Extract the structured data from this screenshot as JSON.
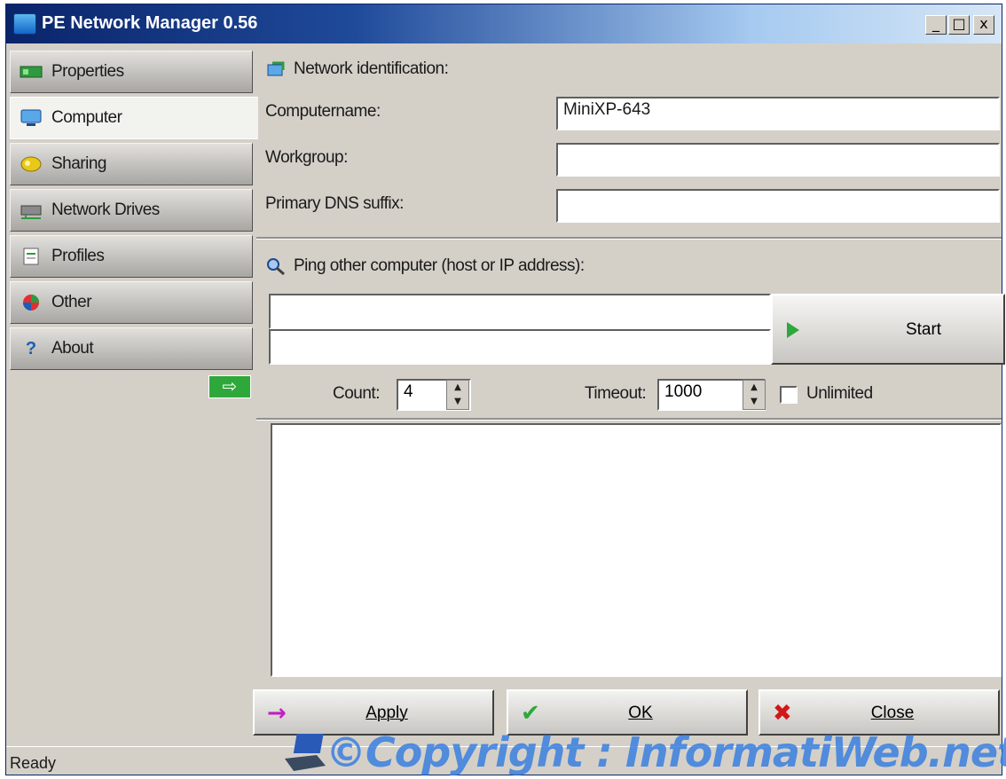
{
  "window": {
    "title": "PE Network Manager 0.56",
    "controls": {
      "minimize": "_",
      "maximize": "□",
      "close": "x"
    }
  },
  "sidebar": {
    "items": [
      {
        "label": "Properties",
        "icon": "network-card-icon",
        "active": false
      },
      {
        "label": "Computer",
        "icon": "computer-icon",
        "active": true
      },
      {
        "label": "Sharing",
        "icon": "sharing-icon",
        "active": false
      },
      {
        "label": "Network Drives",
        "icon": "network-drive-icon",
        "active": false
      },
      {
        "label": "Profiles",
        "icon": "profiles-icon",
        "active": false
      },
      {
        "label": "Other",
        "icon": "other-icon",
        "active": false
      },
      {
        "label": "About",
        "icon": "help-icon",
        "active": false
      }
    ],
    "collapse_arrow": "⇨"
  },
  "identification": {
    "heading": "Network identification:",
    "computername_label": "Computername:",
    "computername_value": "MiniXP-643",
    "workgroup_label": "Workgroup:",
    "workgroup_value": "",
    "dns_label": "Primary DNS suffix:",
    "dns_value": ""
  },
  "ping": {
    "heading": "Ping other computer (host or IP address):",
    "host_value": "",
    "second_value": "",
    "start_label": "Start",
    "count_label": "Count:",
    "count_value": "4",
    "timeout_label": "Timeout:",
    "timeout_value": "1000",
    "unlimited_label": "Unlimited",
    "unlimited_checked": false
  },
  "buttons": {
    "apply": "Apply",
    "ok": "OK",
    "close": "Close"
  },
  "status": "Ready",
  "watermark": "©Copyright : InformatiWeb.net",
  "colors": {
    "title_gradient_start": "#0a246a",
    "accent_green": "#2ea83a",
    "close_red": "#d01818",
    "apply_magenta": "#c020c0",
    "watermark_blue": "#3a80e0"
  }
}
